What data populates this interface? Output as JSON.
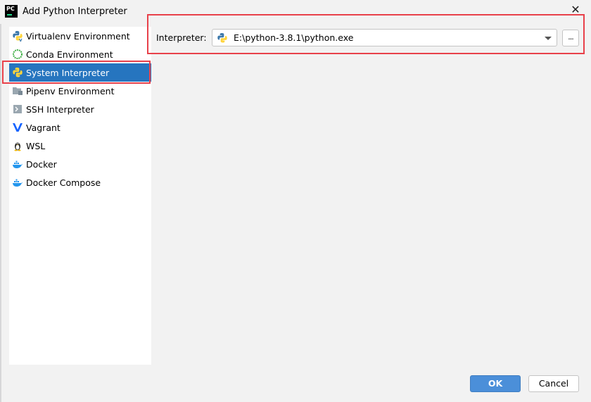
{
  "window": {
    "app_icon_text": "PC",
    "title": "Add Python Interpreter",
    "close_glyph": "✕"
  },
  "sidebar": {
    "items": [
      {
        "label": "Virtualenv Environment",
        "icon": "virtualenv-python-icon"
      },
      {
        "label": "Conda Environment",
        "icon": "conda-ring-icon"
      },
      {
        "label": "System Interpreter",
        "icon": "python-icon",
        "selected": true
      },
      {
        "label": "Pipenv Environment",
        "icon": "pipenv-folder-icon"
      },
      {
        "label": "SSH Interpreter",
        "icon": "terminal-icon"
      },
      {
        "label": "Vagrant",
        "icon": "vagrant-v-icon"
      },
      {
        "label": "WSL",
        "icon": "linux-penguin-icon"
      },
      {
        "label": "Docker",
        "icon": "docker-whale-icon"
      },
      {
        "label": "Docker Compose",
        "icon": "docker-whale-icon"
      }
    ]
  },
  "interpreter": {
    "label": "Interpreter:",
    "value": "E:\\python-3.8.1\\python.exe",
    "browse_label": "..."
  },
  "buttons": {
    "ok": "OK",
    "cancel": "Cancel"
  },
  "colors": {
    "selection": "#2675bf",
    "highlight_box": "#e8414a",
    "ok_button": "#4b8fd9",
    "python_blue": "#3c78aa",
    "python_yellow": "#ffd43b"
  }
}
